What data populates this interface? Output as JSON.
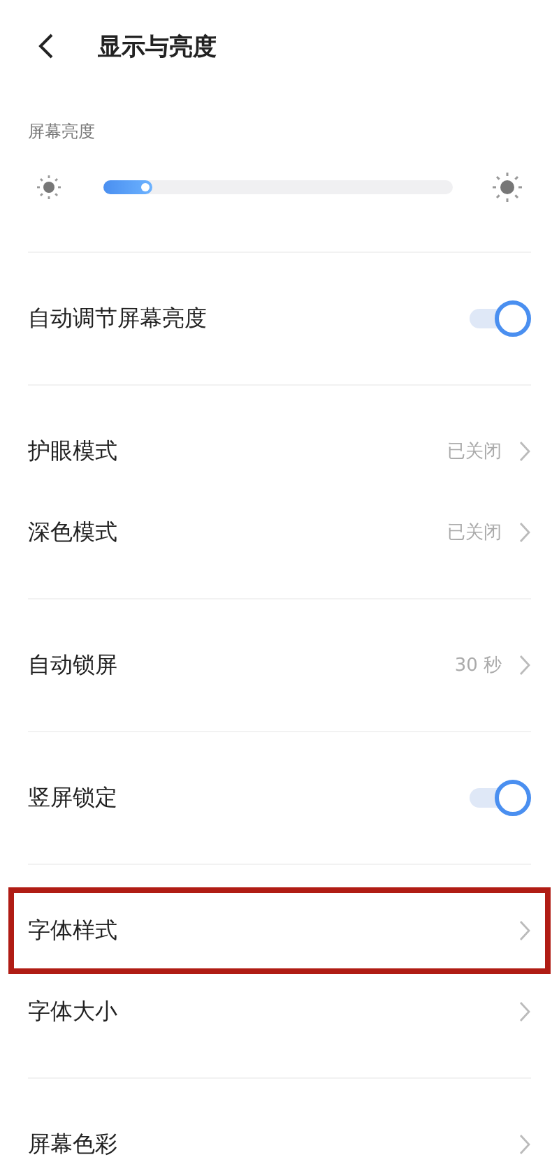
{
  "header": {
    "title": "显示与亮度"
  },
  "brightness": {
    "label": "屏幕亮度",
    "level": 0.14
  },
  "groups": [
    {
      "rows": [
        {
          "kind": "toggle",
          "label": "自动调节屏幕亮度",
          "on": true
        }
      ]
    },
    {
      "rows": [
        {
          "kind": "link",
          "label": "护眼模式",
          "value": "已关闭"
        },
        {
          "kind": "link",
          "label": "深色模式",
          "value": "已关闭"
        }
      ]
    },
    {
      "rows": [
        {
          "kind": "link",
          "label": "自动锁屏",
          "value": "30 秒"
        }
      ]
    },
    {
      "rows": [
        {
          "kind": "toggle",
          "label": "竖屏锁定",
          "on": true
        }
      ]
    },
    {
      "rows": [
        {
          "kind": "link",
          "label": "字体样式",
          "highlighted": true
        },
        {
          "kind": "link",
          "label": "字体大小",
          "highlighted": false
        }
      ]
    },
    {
      "rows": [
        {
          "kind": "link",
          "label": "屏幕色彩"
        }
      ]
    }
  ]
}
